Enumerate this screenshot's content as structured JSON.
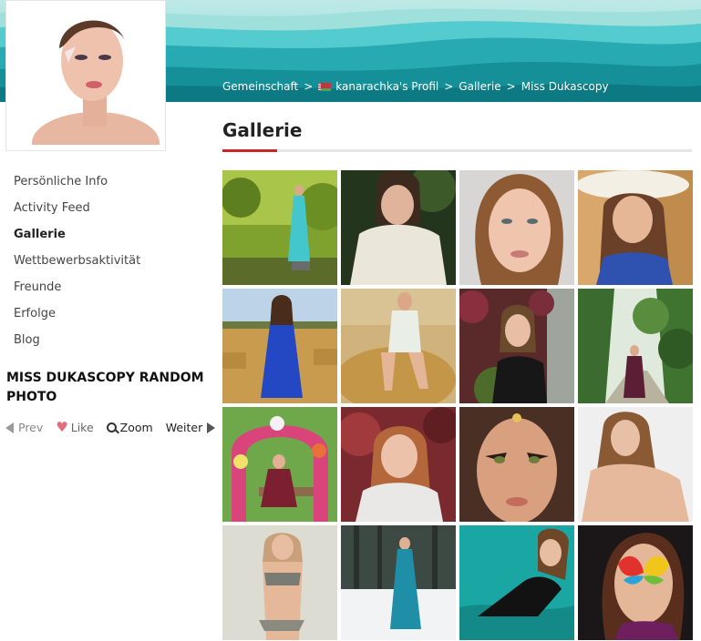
{
  "breadcrumb": {
    "items": [
      "Gemeinschaft",
      "kanarachka's Profil",
      "Gallerie",
      "Miss Dukascopy"
    ],
    "separator": ">"
  },
  "sidebar": {
    "items": [
      {
        "label": "Persönliche Info",
        "active": false
      },
      {
        "label": "Activity Feed",
        "active": false
      },
      {
        "label": "Gallerie",
        "active": true
      },
      {
        "label": "Wettbewerbsaktivität",
        "active": false
      },
      {
        "label": "Freunde",
        "active": false
      },
      {
        "label": "Erfolge",
        "active": false
      },
      {
        "label": "Blog",
        "active": false
      }
    ],
    "random_photo_title": "MISS DUKASCOPY RANDOM PHOTO",
    "controls": {
      "prev": "Prev",
      "like": "Like",
      "zoom": "Zoom",
      "next": "Weiter"
    }
  },
  "main": {
    "title": "Gallerie",
    "photos_count": 16
  },
  "colors": {
    "accent": "#c7262c",
    "banner_teal": "#1f9ea6",
    "banner_dark": "#0f7e86"
  }
}
